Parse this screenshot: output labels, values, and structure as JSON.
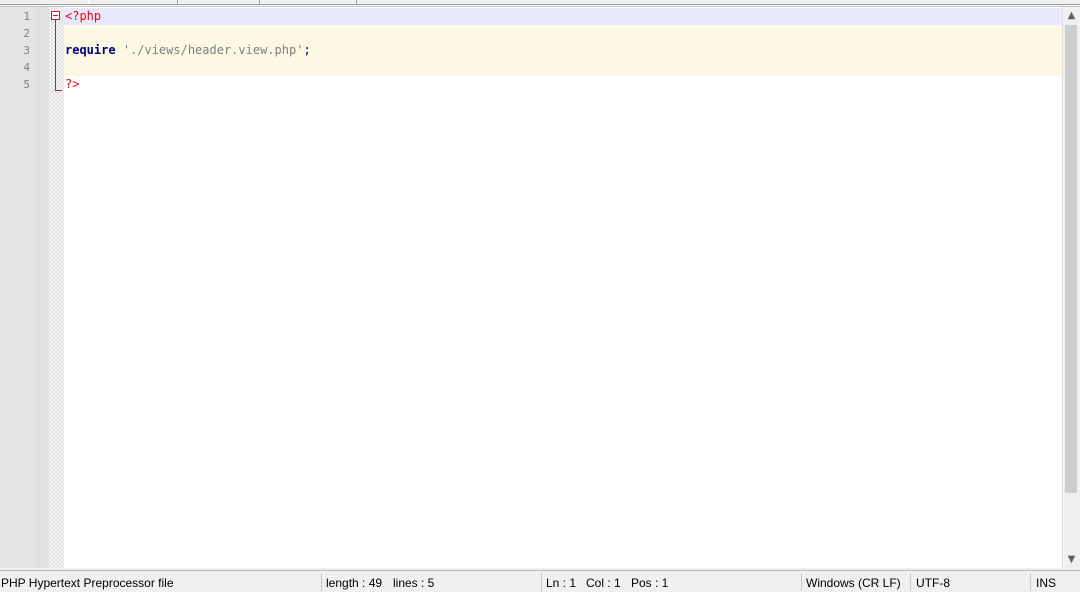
{
  "editor": {
    "lines": [
      {
        "number": "1",
        "tokens": [
          {
            "text": "<?php",
            "kind": "tag"
          }
        ]
      },
      {
        "number": "2",
        "tokens": []
      },
      {
        "number": "3",
        "tokens": [
          {
            "text": "require",
            "kind": "kw"
          },
          {
            "text": " ",
            "kind": "plain"
          },
          {
            "text": "'./views/header.view.php'",
            "kind": "str"
          },
          {
            "text": ";",
            "kind": "punct"
          }
        ]
      },
      {
        "number": "4",
        "tokens": []
      },
      {
        "number": "5",
        "tokens": [
          {
            "text": "?>",
            "kind": "tag"
          }
        ]
      }
    ],
    "colors": {
      "tag": "#ff0000",
      "keyword": "#000080",
      "string": "#808080",
      "current_line": "#e8e8ff",
      "php_block": "#fdf8e3",
      "fold_marker": "#d02020"
    }
  },
  "statusbar": {
    "file_type": "PHP Hypertext Preprocessor file",
    "length": "length : 49",
    "lines": "lines : 5",
    "ln": "Ln : 1",
    "col": "Col : 1",
    "pos": "Pos : 1",
    "eol": "Windows (CR LF)",
    "encoding": "UTF-8",
    "mode": "INS"
  },
  "scrollbar": {
    "up_icon": "chevron-up-icon",
    "down_icon": "chevron-down-icon"
  }
}
